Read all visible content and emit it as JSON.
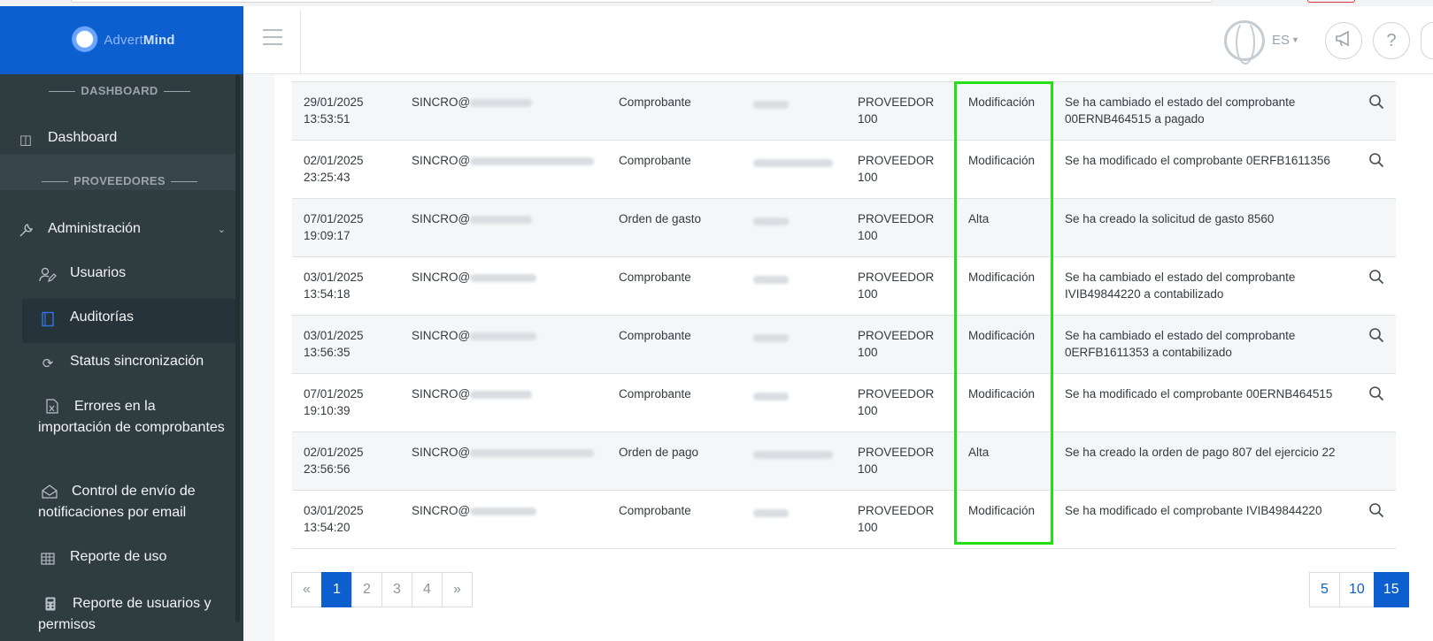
{
  "brand": {
    "name_prefix": "Advert",
    "name_suffix": "Mind"
  },
  "header": {
    "language": "ES"
  },
  "sidebar": {
    "sections": [
      {
        "title": "DASHBOARD"
      },
      {
        "title": "PROVEEDORES"
      }
    ],
    "items": [
      {
        "label": "Dashboard",
        "icon": "dashboard-icon"
      },
      {
        "label": "Administración",
        "icon": "wrench-icon"
      },
      {
        "label": "Usuarios",
        "icon": "user-edit-icon"
      },
      {
        "label": "Auditorías",
        "icon": "book-icon"
      },
      {
        "label": "Status sincronización",
        "icon": "sync-icon"
      },
      {
        "label": "Errores en la importación de comprobantes",
        "icon": "file-excel-icon"
      },
      {
        "label": "Control de envío de notificaciones por email",
        "icon": "envelope-open-icon"
      },
      {
        "label": "Reporte de uso",
        "icon": "table-icon"
      },
      {
        "label": "Reporte de usuarios y permisos",
        "icon": "calculator-icon"
      }
    ]
  },
  "table": {
    "rows": [
      {
        "date": "29/01/2025",
        "time": "13:53:51",
        "user": "SINCRO@",
        "entity": "Comprobante",
        "provider": "PROVEEDOR",
        "provider_num": "100",
        "action": "Modificación",
        "description": "Se ha cambiado el estado del comprobante 00ERNB464515 a pagado",
        "has_detail": true
      },
      {
        "date": "02/01/2025",
        "time": "23:25:43",
        "user": "SINCRO@",
        "entity": "Comprobante",
        "provider": "PROVEEDOR",
        "provider_num": "100",
        "action": "Modificación",
        "description": "Se ha modificado el comprobante 0ERFB1611356",
        "has_detail": true
      },
      {
        "date": "07/01/2025",
        "time": "19:09:17",
        "user": "SINCRO@",
        "entity": "Orden de gasto",
        "provider": "PROVEEDOR",
        "provider_num": "100",
        "action": "Alta",
        "description": "Se ha creado la solicitud de gasto 8560",
        "has_detail": false
      },
      {
        "date": "03/01/2025",
        "time": "13:54:18",
        "user": "SINCRO@",
        "entity": "Comprobante",
        "provider": "PROVEEDOR",
        "provider_num": "100",
        "action": "Modificación",
        "description": "Se ha cambiado el estado del comprobante IVIB49844220 a contabilizado",
        "has_detail": true
      },
      {
        "date": "03/01/2025",
        "time": "13:56:35",
        "user": "SINCRO@",
        "entity": "Comprobante",
        "provider": "PROVEEDOR",
        "provider_num": "100",
        "action": "Modificación",
        "description": "Se ha cambiado el estado del comprobante 0ERFB1611353 a contabilizado",
        "has_detail": true
      },
      {
        "date": "07/01/2025",
        "time": "19:10:39",
        "user": "SINCRO@",
        "entity": "Comprobante",
        "provider": "PROVEEDOR",
        "provider_num": "100",
        "action": "Modificación",
        "description": "Se ha modificado el comprobante 00ERNB464515",
        "has_detail": true
      },
      {
        "date": "02/01/2025",
        "time": "23:56:56",
        "user": "SINCRO@",
        "entity": "Orden de pago",
        "provider": "PROVEEDOR",
        "provider_num": "100",
        "action": "Alta",
        "description": "Se ha creado la orden de pago 807 del ejercicio 22",
        "has_detail": false
      },
      {
        "date": "03/01/2025",
        "time": "13:54:20",
        "user": "SINCRO@",
        "entity": "Comprobante",
        "provider": "PROVEEDOR",
        "provider_num": "100",
        "action": "Modificación",
        "description": "Se ha modificado el comprobante IVIB49844220",
        "has_detail": true
      }
    ]
  },
  "pagination": {
    "prev": "«",
    "next": "»",
    "pages": [
      "1",
      "2",
      "3",
      "4"
    ],
    "current_page": "1",
    "page_sizes": [
      "5",
      "10",
      "15"
    ],
    "current_page_size": "15"
  },
  "colors": {
    "brand_blue": "#0d5fcf",
    "sidebar_bg": "#2f3c40",
    "highlight_green": "#22e014"
  }
}
